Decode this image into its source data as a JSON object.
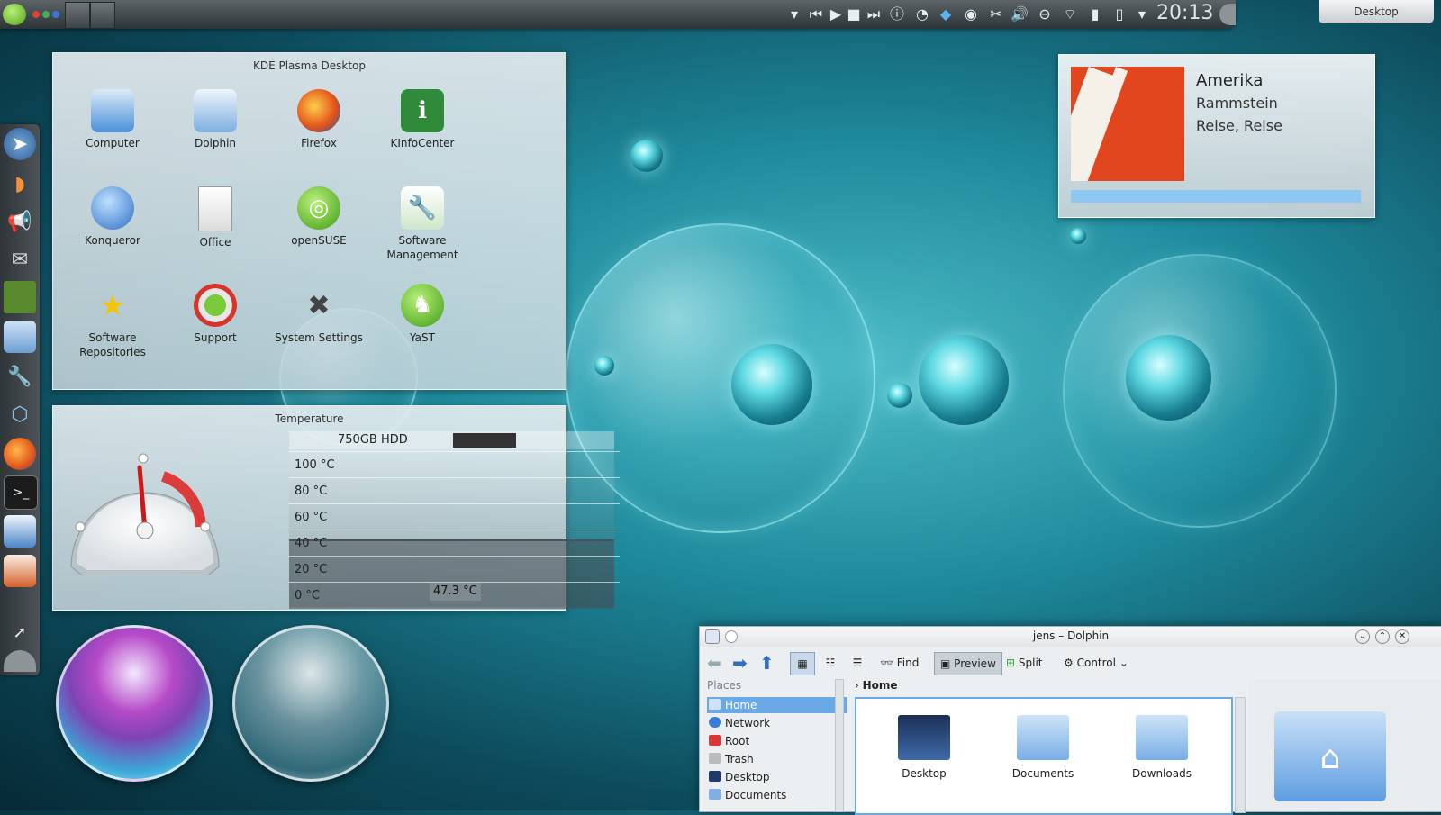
{
  "top_panel": {
    "clock": "20:13",
    "desktop_button": "Desktop",
    "tray_icons": [
      "chevron-down-icon",
      "skip-back-icon",
      "play-icon",
      "stop-icon",
      "skip-forward-icon",
      "info-icon",
      "updater-icon",
      "dropbox-icon",
      "network-manager-icon",
      "klipper-scissors-icon",
      "volume-icon",
      "usb-icon",
      "wifi-icon",
      "battery-icon",
      "phone-icon",
      "chevron-down-icon"
    ]
  },
  "folder_view": {
    "title": "KDE Plasma Desktop",
    "apps": [
      {
        "label": "Computer",
        "icon": "computer-icon"
      },
      {
        "label": "Dolphin",
        "icon": "dolphin-icon"
      },
      {
        "label": "Firefox",
        "icon": "firefox-icon"
      },
      {
        "label": "KInfoCenter",
        "icon": "kinfocenter-icon"
      },
      {
        "label": "Konqueror",
        "icon": "konqueror-icon"
      },
      {
        "label": "Office",
        "icon": "office-icon"
      },
      {
        "label": "openSUSE",
        "icon": "opensuse-icon"
      },
      {
        "label": "Software Management",
        "icon": "software-management-icon"
      },
      {
        "label": "Software Repositories",
        "icon": "software-repositories-icon"
      },
      {
        "label": "Support",
        "icon": "support-icon"
      },
      {
        "label": "System Settings",
        "icon": "system-settings-icon"
      },
      {
        "label": "YaST",
        "icon": "yast-icon"
      }
    ]
  },
  "temperature": {
    "title": "Temperature",
    "device": "750GB HDD",
    "gauge_fraction": 0.47,
    "scale": [
      "100 °C",
      "80 °C",
      "60 °C",
      "40 °C",
      "20 °C",
      "0 °C"
    ],
    "current": "47.3 °C"
  },
  "now_playing": {
    "title": "Amerika",
    "artist": "Rammstein",
    "album": "Reise, Reise",
    "progress": 1.0
  },
  "dolphin": {
    "window_title": "jens – Dolphin",
    "toolbar": {
      "find": "Find",
      "preview": "Preview",
      "split": "Split",
      "control": "Control"
    },
    "places_header": "Places",
    "places": [
      "Home",
      "Network",
      "Root",
      "Trash",
      "Desktop",
      "Documents"
    ],
    "breadcrumb": "Home",
    "files": [
      "Desktop",
      "Documents",
      "Downloads"
    ]
  },
  "colors": {
    "accent": "#3daee9",
    "selection": "#6aa9e6",
    "music_progress": "#8ec8f2"
  }
}
